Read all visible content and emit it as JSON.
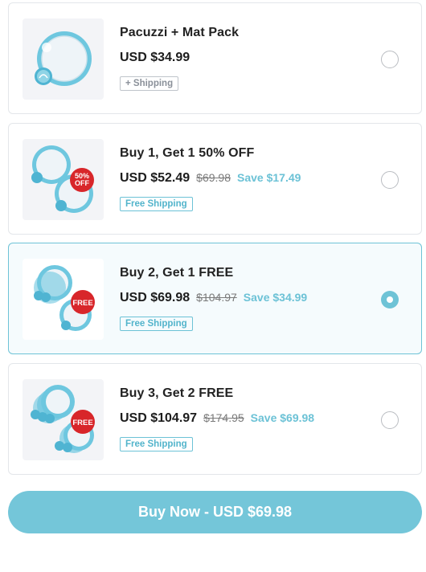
{
  "options": [
    {
      "title": "Pacuzzi + Mat Pack",
      "price": "USD $34.99",
      "compare": "",
      "save": "",
      "badge": "+ Shipping",
      "badge_type": "plain",
      "selected": false,
      "thumb_icon": "single-bowl-image",
      "ribbon": ""
    },
    {
      "title": "Buy 1, Get 1 50% OFF",
      "price": "USD $52.49",
      "compare": "$69.98",
      "save": "Save $17.49",
      "badge": "Free Shipping",
      "badge_type": "free",
      "selected": false,
      "thumb_icon": "two-bowls-image",
      "ribbon": "50% OFF"
    },
    {
      "title": "Buy 2, Get 1 FREE",
      "price": "USD $69.98",
      "compare": "$104.97",
      "save": "Save $34.99",
      "badge": "Free Shipping",
      "badge_type": "free",
      "selected": true,
      "thumb_icon": "three-bowls-image",
      "ribbon": "FREE"
    },
    {
      "title": "Buy 3, Get 2 FREE",
      "price": "USD $104.97",
      "compare": "$174.95",
      "save": "Save $69.98",
      "badge": "Free Shipping",
      "badge_type": "free",
      "selected": false,
      "thumb_icon": "five-bowls-image",
      "ribbon": "FREE"
    }
  ],
  "buy_button": {
    "label": "Buy Now - USD $69.98"
  },
  "colors": {
    "accent": "#74c6d9",
    "ribbon_red": "#d8262a",
    "border": "#e3e6ea"
  }
}
